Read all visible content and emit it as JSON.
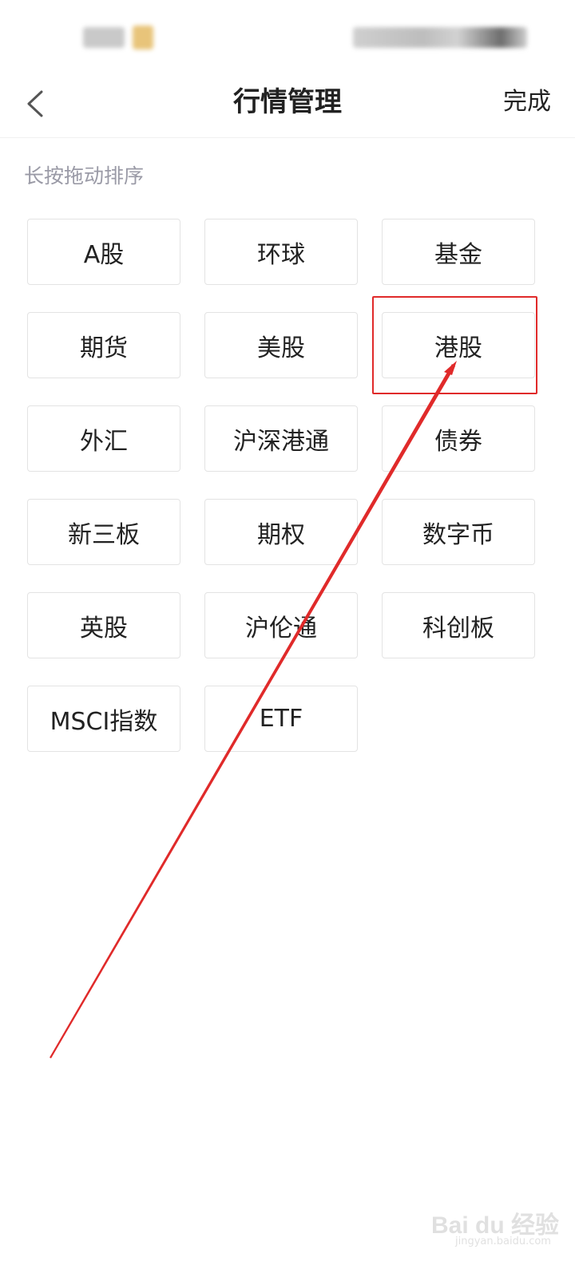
{
  "header": {
    "title": "行情管理",
    "done_label": "完成",
    "back_icon": "chevron-left-icon"
  },
  "hint": "长按拖动排序",
  "tiles": [
    {
      "label": "A股"
    },
    {
      "label": "环球"
    },
    {
      "label": "基金"
    },
    {
      "label": "期货"
    },
    {
      "label": "美股"
    },
    {
      "label": "港股"
    },
    {
      "label": "外汇"
    },
    {
      "label": "沪深港通"
    },
    {
      "label": "债券"
    },
    {
      "label": "新三板"
    },
    {
      "label": "期权"
    },
    {
      "label": "数字币"
    },
    {
      "label": "英股"
    },
    {
      "label": "沪伦通"
    },
    {
      "label": "科创板"
    },
    {
      "label": "MSCI指数"
    },
    {
      "label": "ETF"
    }
  ],
  "annotation": {
    "color": "#e02a2a",
    "target": "港股"
  },
  "watermark": {
    "text": "Bai du 经验",
    "sub": "jingyan.baidu.com"
  }
}
